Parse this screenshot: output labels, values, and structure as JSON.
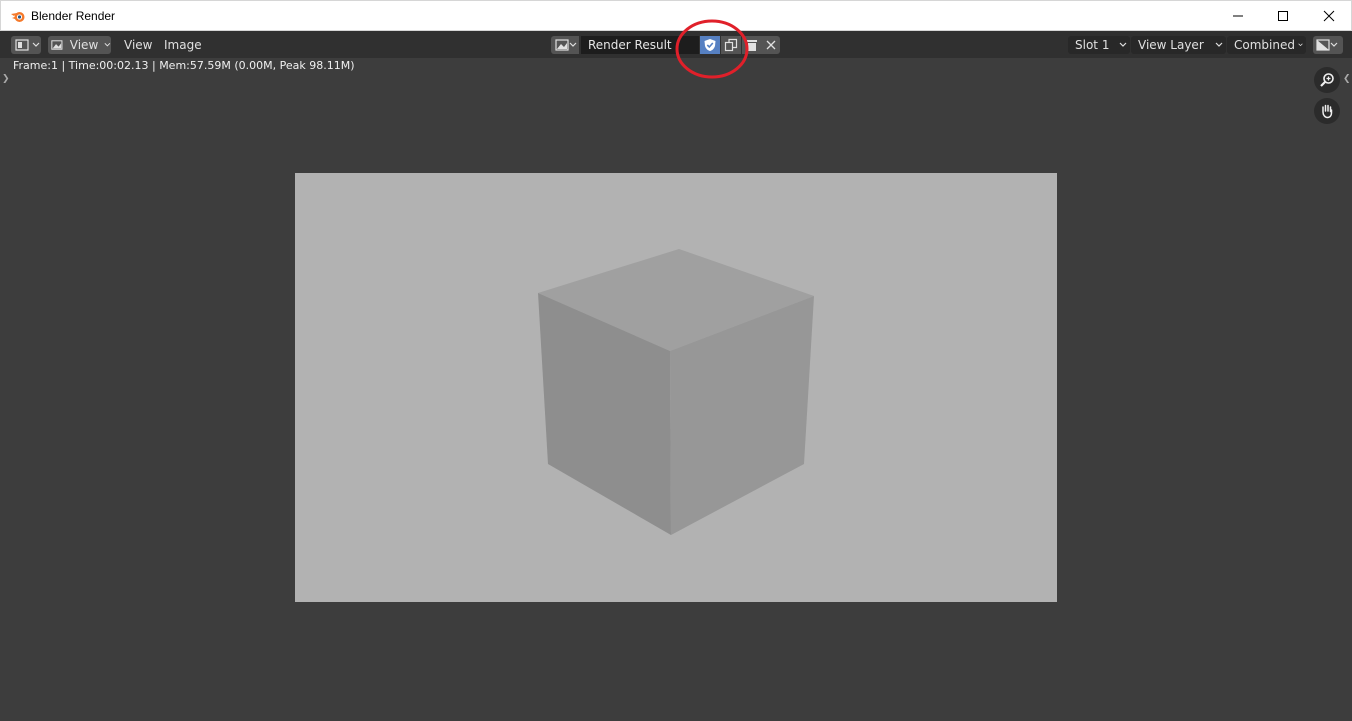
{
  "window": {
    "title": "Blender Render"
  },
  "header": {
    "menus": [
      "View",
      "Image"
    ],
    "mode_label": "View",
    "image_name": "Render Result",
    "slot": "Slot 1",
    "view_layer": "View Layer",
    "pass": "Combined"
  },
  "info": {
    "text": "Frame:1 | Time:00:02.13 | Mem:57.59M (0.00M, Peak 98.11M)"
  },
  "icons": {
    "editor_type": "image-editor-icon",
    "fake_user": "shield-check-icon",
    "duplicate": "duplicate-icon",
    "delete": "trash-icon",
    "unlink": "close-icon",
    "zoom": "zoom-icon",
    "pan": "hand-icon"
  },
  "colors": {
    "annotation": "#e0202a",
    "fake_user_active": "#5680c2",
    "render_background": "#b2b2b2"
  }
}
